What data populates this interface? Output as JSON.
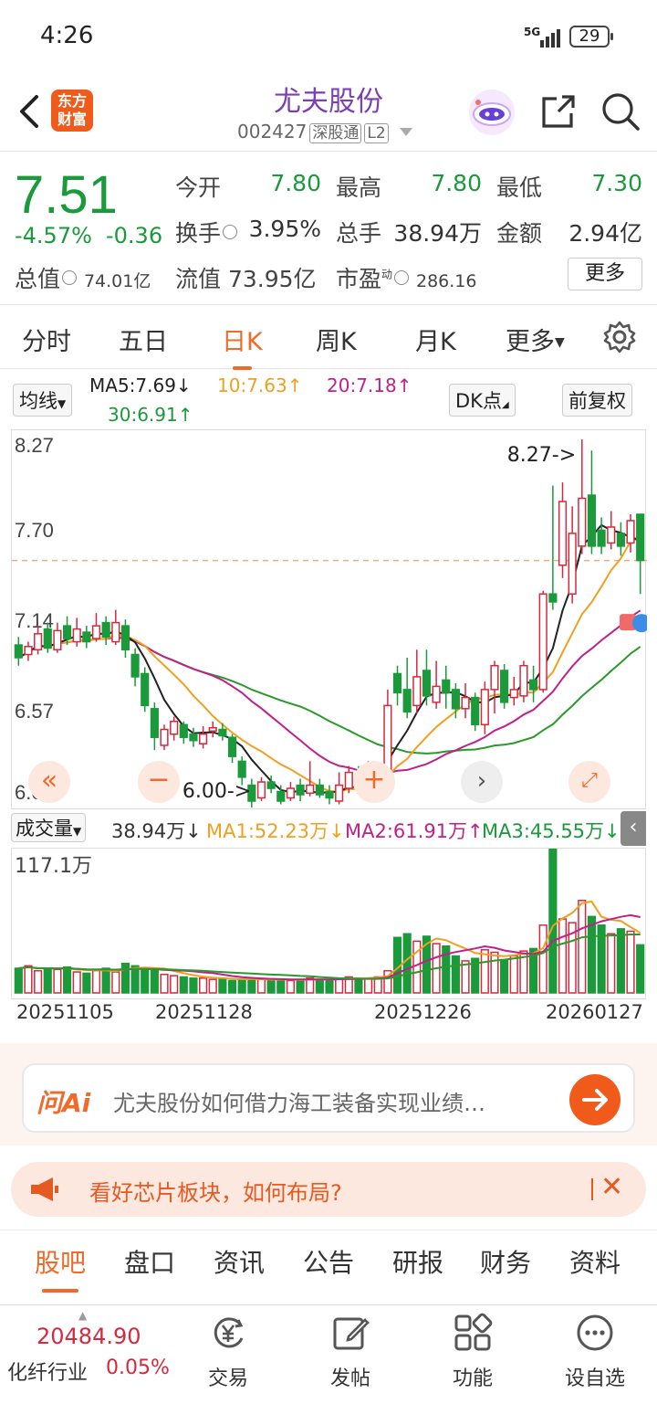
{
  "status_bar": {
    "time": "4:26",
    "network": "5G",
    "battery": "29"
  },
  "header": {
    "title": "尤夫股份",
    "code": "002427",
    "tag1": "深股通",
    "tag2": "L2",
    "logo_line1": "东方",
    "logo_line2": "财富"
  },
  "quote": {
    "price": "7.51",
    "change_pct": "-4.57%",
    "change_abs": "-0.36",
    "open_label": "今开",
    "open": "7.80",
    "high_label": "最高",
    "high": "7.80",
    "low_label": "最低",
    "low": "7.30",
    "turnover_label": "换手",
    "turnover": "3.95%",
    "volume_label": "总手",
    "volume": "38.94万",
    "amount_label": "金额",
    "amount": "2.94亿",
    "mcap_label": "总值",
    "mcap": "74.01亿",
    "float_label": "流值",
    "float": "73.95亿",
    "pe_label": "市盈",
    "pe_sup": "动",
    "pe": "286.16",
    "more": "更多"
  },
  "tabs": [
    {
      "label": "分时"
    },
    {
      "label": "五日"
    },
    {
      "label": "日K"
    },
    {
      "label": "周K"
    },
    {
      "label": "月K"
    },
    {
      "label": "更多"
    }
  ],
  "ma_bar": {
    "selector": "均线",
    "ma5": "MA5:7.69↓",
    "ma10": "10:7.63↑",
    "ma20": "20:7.18↑",
    "ma30": "30:6.91↑",
    "dk": "DK点",
    "fq": "前复权"
  },
  "kline": {
    "y_labels": [
      "8.27",
      "7.70",
      "7.14",
      "6.57",
      "6.00"
    ],
    "max_label": "8.27->",
    "min_label": "6.00->",
    "colors": {
      "up": "#d6283e",
      "down": "#1a9a3a",
      "ma5": "#222222",
      "ma10": "#f0a020",
      "ma20": "#c0208a",
      "ma30": "#2a9a2a"
    }
  },
  "volume": {
    "selector": "成交量",
    "value": "38.94万↓",
    "ma1": "MA1:52.23万↓",
    "ma2": "MA2:61.91万↑",
    "ma3": "MA3:45.55万↓",
    "top_label": "117.1万"
  },
  "dates": [
    "20251105",
    "20251128",
    "20251226",
    "20260127"
  ],
  "ask": {
    "logo": "问Ai",
    "text": "尤夫股份如何借力海工装备实现业绩…"
  },
  "banner": {
    "text": "看好芯片板块，如何布局?"
  },
  "subtabs": [
    {
      "label": "股吧"
    },
    {
      "label": "盘口"
    },
    {
      "label": "资讯"
    },
    {
      "label": "公告"
    },
    {
      "label": "研报"
    },
    {
      "label": "财务"
    },
    {
      "label": "资料"
    }
  ],
  "bottom": {
    "index_value": "20484.90",
    "index_name": "化纤行业",
    "index_pct": "0.05%",
    "nav": [
      {
        "label": "交易"
      },
      {
        "label": "发帖"
      },
      {
        "label": "功能"
      },
      {
        "label": "设自选"
      }
    ]
  },
  "chart_data": {
    "type": "candlestick",
    "ylim": [
      6.0,
      8.27
    ],
    "candles": [
      [
        6.98,
        6.9,
        7.03,
        6.85
      ],
      [
        6.92,
        6.97,
        7.0,
        6.88
      ],
      [
        6.95,
        7.05,
        7.1,
        6.92
      ],
      [
        7.08,
        6.96,
        7.12,
        6.93
      ],
      [
        6.95,
        7.07,
        7.12,
        6.93
      ],
      [
        7.1,
        7.02,
        7.16,
        6.98
      ],
      [
        7.0,
        7.08,
        7.15,
        6.97
      ],
      [
        7.06,
        7.0,
        7.1,
        6.96
      ],
      [
        7.02,
        7.1,
        7.18,
        7.0
      ],
      [
        7.12,
        7.03,
        7.16,
        6.98
      ],
      [
        7.0,
        7.12,
        7.2,
        6.98
      ],
      [
        7.1,
        6.95,
        7.14,
        6.9
      ],
      [
        6.92,
        6.78,
        6.96,
        6.72
      ],
      [
        6.8,
        6.6,
        6.84,
        6.56
      ],
      [
        6.58,
        6.4,
        6.62,
        6.32
      ],
      [
        6.35,
        6.45,
        6.48,
        6.32
      ],
      [
        6.42,
        6.5,
        6.53,
        6.38
      ],
      [
        6.48,
        6.4,
        6.5,
        6.36
      ],
      [
        6.42,
        6.38,
        6.46,
        6.34
      ],
      [
        6.36,
        6.42,
        6.47,
        6.33
      ],
      [
        6.44,
        6.46,
        6.5,
        6.4
      ],
      [
        6.45,
        6.41,
        6.49,
        6.38
      ],
      [
        6.4,
        6.28,
        6.42,
        6.24
      ],
      [
        6.25,
        6.15,
        6.28,
        6.1
      ],
      [
        6.1,
        6.0,
        6.14,
        5.96
      ],
      [
        6.02,
        6.12,
        6.15,
        6.0
      ],
      [
        6.12,
        6.08,
        6.16,
        6.05
      ],
      [
        6.06,
        6.0,
        6.1,
        5.98
      ],
      [
        6.02,
        6.08,
        6.12,
        6.0
      ],
      [
        6.1,
        6.04,
        6.14,
        6.0
      ],
      [
        6.05,
        6.1,
        6.25,
        6.03
      ],
      [
        6.1,
        6.04,
        6.14,
        6.02
      ],
      [
        6.06,
        6.02,
        6.1,
        5.98
      ],
      [
        6.0,
        6.1,
        6.18,
        5.98
      ],
      [
        6.08,
        6.18,
        6.22,
        6.05
      ],
      [
        6.16,
        6.1,
        6.22,
        6.08
      ],
      [
        6.1,
        6.21,
        6.25,
        6.08
      ],
      [
        6.12,
        6.16,
        6.2,
        6.06
      ],
      [
        6.16,
        6.6,
        6.7,
        6.12
      ],
      [
        6.8,
        6.68,
        6.85,
        6.6
      ],
      [
        6.7,
        6.56,
        6.9,
        6.52
      ],
      [
        6.6,
        6.78,
        6.95,
        6.55
      ],
      [
        6.82,
        6.66,
        6.95,
        6.6
      ],
      [
        6.62,
        6.72,
        6.88,
        6.58
      ],
      [
        6.76,
        6.68,
        6.85,
        6.58
      ],
      [
        6.7,
        6.58,
        6.74,
        6.52
      ],
      [
        6.58,
        6.65,
        6.74,
        6.52
      ],
      [
        6.65,
        6.48,
        6.68,
        6.44
      ],
      [
        6.48,
        6.7,
        6.75,
        6.42
      ],
      [
        6.7,
        6.85,
        6.88,
        6.55
      ],
      [
        6.82,
        6.62,
        6.86,
        6.58
      ],
      [
        6.65,
        6.7,
        6.78,
        6.6
      ],
      [
        6.66,
        6.85,
        6.88,
        6.62
      ],
      [
        6.76,
        6.7,
        6.85,
        6.62
      ],
      [
        6.7,
        7.3,
        7.32,
        6.68
      ],
      [
        7.3,
        7.25,
        7.98,
        7.2
      ],
      [
        7.48,
        7.88,
        8.0,
        7.4
      ],
      [
        7.3,
        7.68,
        7.85,
        7.24
      ],
      [
        7.6,
        7.9,
        8.27,
        7.55
      ],
      [
        7.92,
        7.6,
        8.2,
        7.55
      ],
      [
        7.7,
        7.6,
        7.78,
        7.55
      ],
      [
        7.62,
        7.72,
        7.82,
        7.58
      ],
      [
        7.68,
        7.6,
        7.75,
        7.54
      ],
      [
        7.62,
        7.76,
        7.8,
        7.56
      ],
      [
        7.8,
        7.51,
        7.8,
        7.3
      ]
    ],
    "volumes": [
      20,
      22,
      18,
      20,
      19,
      21,
      17,
      16,
      18,
      20,
      17,
      24,
      22,
      20,
      18,
      15,
      14,
      13,
      12,
      12,
      11,
      12,
      10,
      11,
      12,
      11,
      10,
      11,
      10,
      11,
      12,
      11,
      11,
      12,
      13,
      12,
      12,
      13,
      18,
      45,
      48,
      42,
      46,
      40,
      38,
      30,
      26,
      28,
      35,
      33,
      27,
      30,
      34,
      36,
      55,
      117,
      60,
      57,
      75,
      62,
      55,
      48,
      52,
      50,
      39
    ],
    "volume_max": 117.1,
    "volume_unit": "万"
  }
}
